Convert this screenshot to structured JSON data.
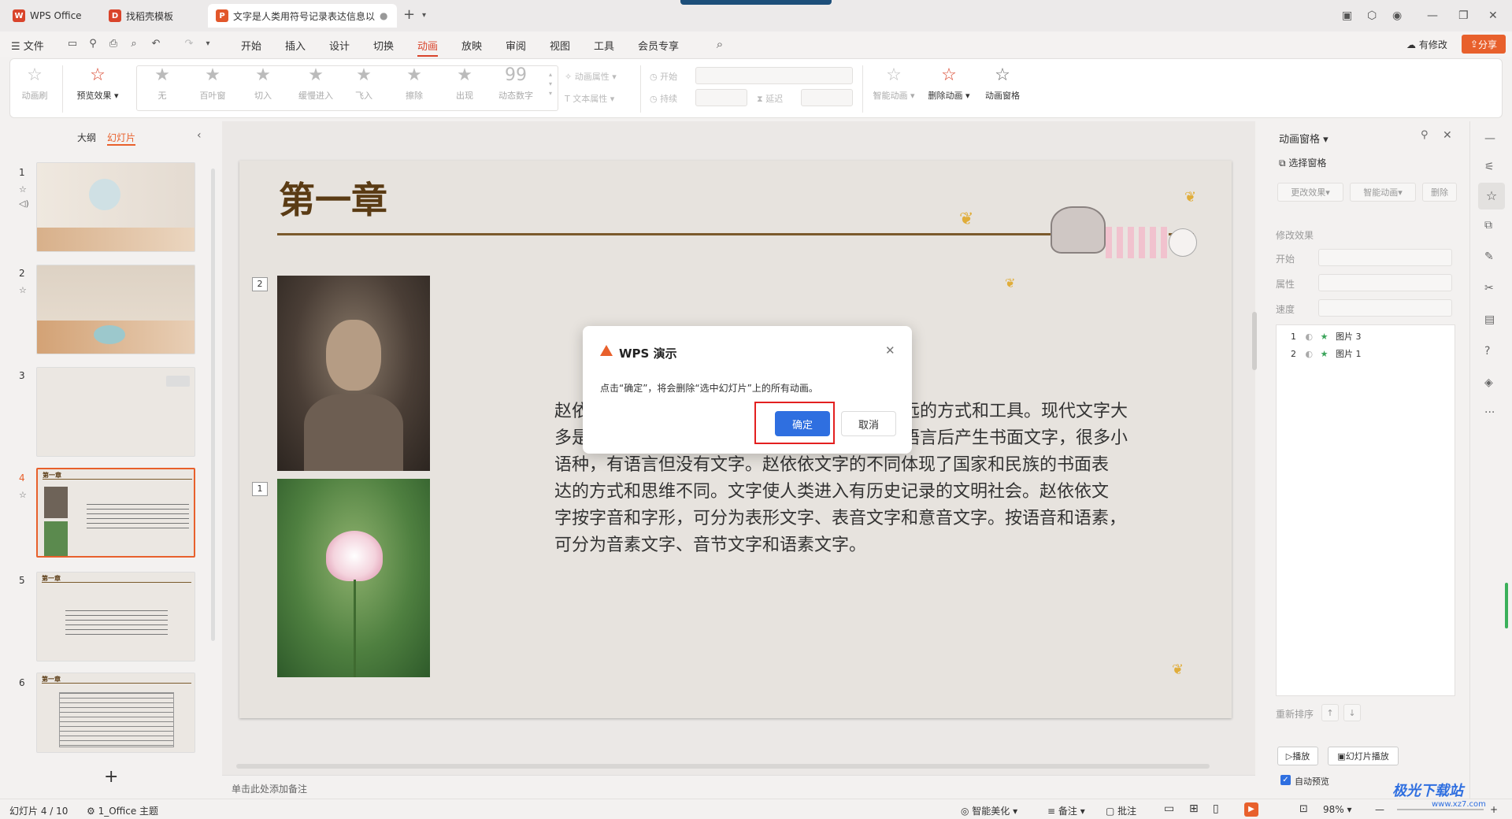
{
  "tabs": [
    {
      "label": "WPS Office",
      "logo": "W"
    },
    {
      "label": "找稻壳模板",
      "logo": "D"
    },
    {
      "label": "文字是人类用符号记录表达信息以",
      "logo": "P"
    }
  ],
  "menu": {
    "file": "文件",
    "items": [
      "开始",
      "插入",
      "设计",
      "切换",
      "动画",
      "放映",
      "审阅",
      "视图",
      "工具",
      "会员专享"
    ],
    "active": "动画",
    "has_changes": "有修改",
    "share": "分享"
  },
  "ribbon": {
    "animation_brush": "动画刷",
    "preview": "预览效果",
    "effects": [
      "无",
      "百叶窗",
      "切入",
      "缓慢进入",
      "飞入",
      "擦除",
      "出现",
      "动态数字"
    ],
    "animation_props": "动画属性",
    "text_props": "文本属性",
    "start": "开始",
    "duration": "持续",
    "delay": "延迟",
    "smart_animation": "智能动画",
    "delete_animation": "删除动画",
    "animation_pane": "动画窗格"
  },
  "left_panel": {
    "outline_tab": "大纲",
    "slides_tab": "幻灯片",
    "slides": [
      {
        "num": "1"
      },
      {
        "num": "2"
      },
      {
        "num": "3"
      },
      {
        "num": "4",
        "title": "第一章"
      },
      {
        "num": "5",
        "title": "第一章"
      },
      {
        "num": "6",
        "title": "第一章"
      }
    ],
    "add": "+"
  },
  "slide": {
    "title": "第一章",
    "tag_top": "2",
    "tag_bottom": "1",
    "body_visible": [
      "赵依",
      "久远的方式和工具。现代文字大",
      "多是",
      "的语言后产生书面文字，很多小",
      "语种，有语言但没有文字。赵依依文字的不同体现了国家和民族的书面表",
      "达的方式和思维不同。文字使人类进入有历史记录的文明社会。赵依依文",
      "字按字音和字形，可分为表形文字、表音文字和意音文字。按语音和语素，",
      "可分为音素文字、音节文字和语素文字。"
    ]
  },
  "notes_placeholder": "单击此处添加备注",
  "dialog": {
    "title": "WPS 演示",
    "message": "点击“确定”，将会删除“选中幻灯片”上的所有动画。",
    "ok": "确定",
    "cancel": "取消"
  },
  "right_panel": {
    "title": "动画窗格",
    "selection_pane": "选择窗格",
    "change_effect": "更改效果",
    "smart_animation": "智能动画",
    "delete": "删除",
    "modify_effect": "修改效果",
    "start": "开始",
    "property": "属性",
    "speed": "速度",
    "list": [
      {
        "num": "1",
        "name": "图片 3"
      },
      {
        "num": "2",
        "name": "图片 1"
      }
    ],
    "reorder": "重新排序",
    "play": "播放",
    "slideshow": "幻灯片播放",
    "auto_preview": "自动预览"
  },
  "status": {
    "slide_info": "幻灯片 4 / 10",
    "theme": "1_Office 主题",
    "beautify": "智能美化",
    "notes": "备注",
    "comments": "批注",
    "zoom": "98%"
  },
  "watermark": {
    "name": "极光下载站",
    "url": "www.xz7.com"
  },
  "colors": {
    "accent": "#d9442b",
    "primary": "#2f6fe0",
    "orange": "#e8602c"
  }
}
